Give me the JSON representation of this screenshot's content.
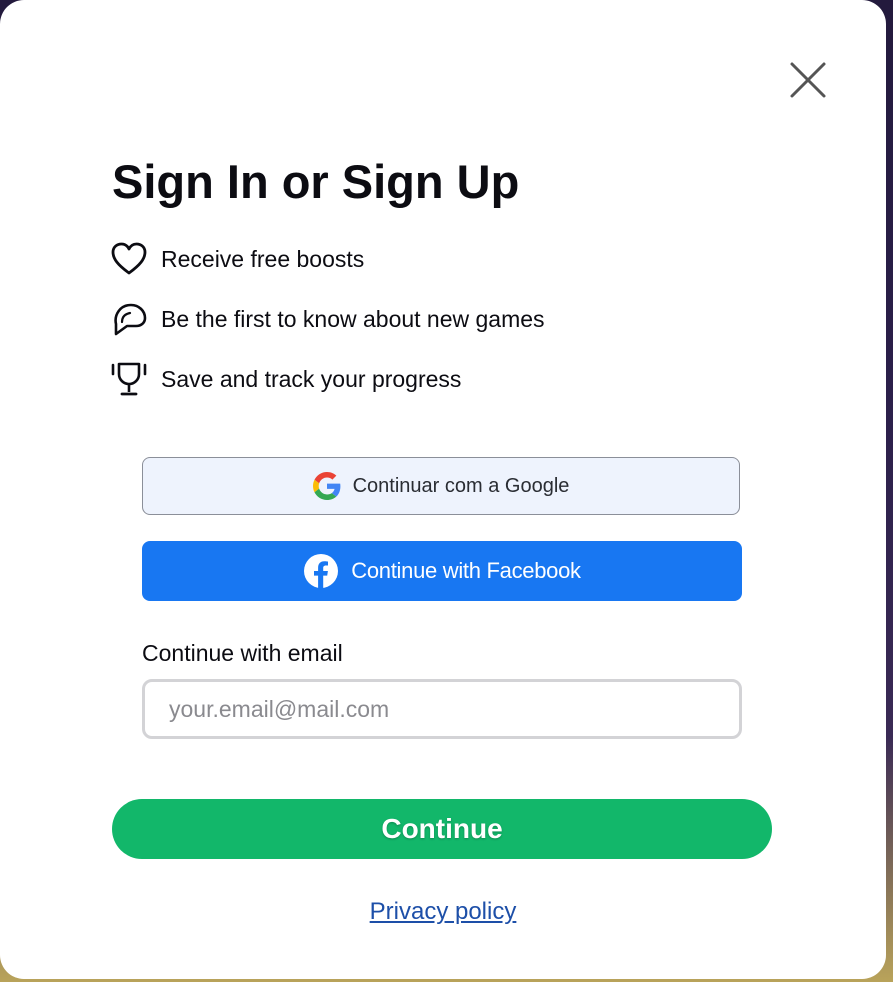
{
  "modal": {
    "title": "Sign In or Sign Up",
    "close_icon": "close-icon"
  },
  "benefits": [
    {
      "icon": "heart-icon",
      "text": "Receive free boosts"
    },
    {
      "icon": "chat-bubble-icon",
      "text": "Be the first to know about new games"
    },
    {
      "icon": "trophy-icon",
      "text": "Save and track your progress"
    }
  ],
  "auth": {
    "google_label": "Continuar com a Google",
    "google_icon": "google-logo-icon",
    "facebook_label": "Continue with Facebook",
    "facebook_icon": "facebook-logo-icon",
    "email_label": "Continue with email",
    "email_placeholder": "your.email@mail.com",
    "email_value": "",
    "continue_label": "Continue",
    "privacy_label": "Privacy policy"
  },
  "colors": {
    "facebook": "#1877f2",
    "continue": "#12b76a",
    "google_bg": "#eef3fd",
    "link": "#1d4fa8"
  }
}
